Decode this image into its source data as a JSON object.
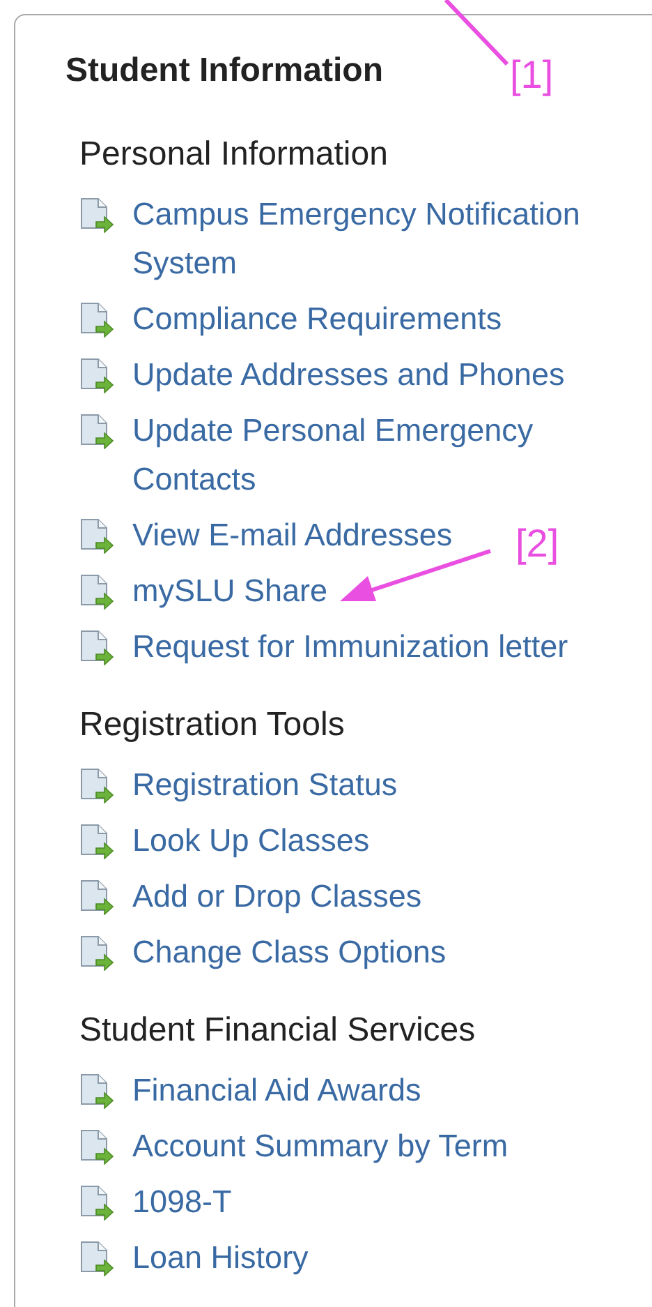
{
  "panel": {
    "title": "Student Information",
    "sections": [
      {
        "heading": "Personal Information",
        "links": [
          "Campus Emergency Notification System",
          "Compliance Requirements",
          "Update Addresses and Phones",
          "Update Personal Emergency Contacts",
          "View E-mail Addresses",
          "mySLU Share",
          "Request for Immunization letter"
        ]
      },
      {
        "heading": "Registration Tools",
        "links": [
          "Registration Status",
          "Look Up Classes",
          "Add or Drop Classes",
          "Change Class Options"
        ]
      },
      {
        "heading": "Student Financial Services",
        "links": [
          "Financial Aid Awards",
          "Account Summary by Term",
          "1098-T",
          "Loan History"
        ]
      }
    ]
  },
  "annotations": [
    {
      "label": "[1]"
    },
    {
      "label": "[2]"
    }
  ]
}
